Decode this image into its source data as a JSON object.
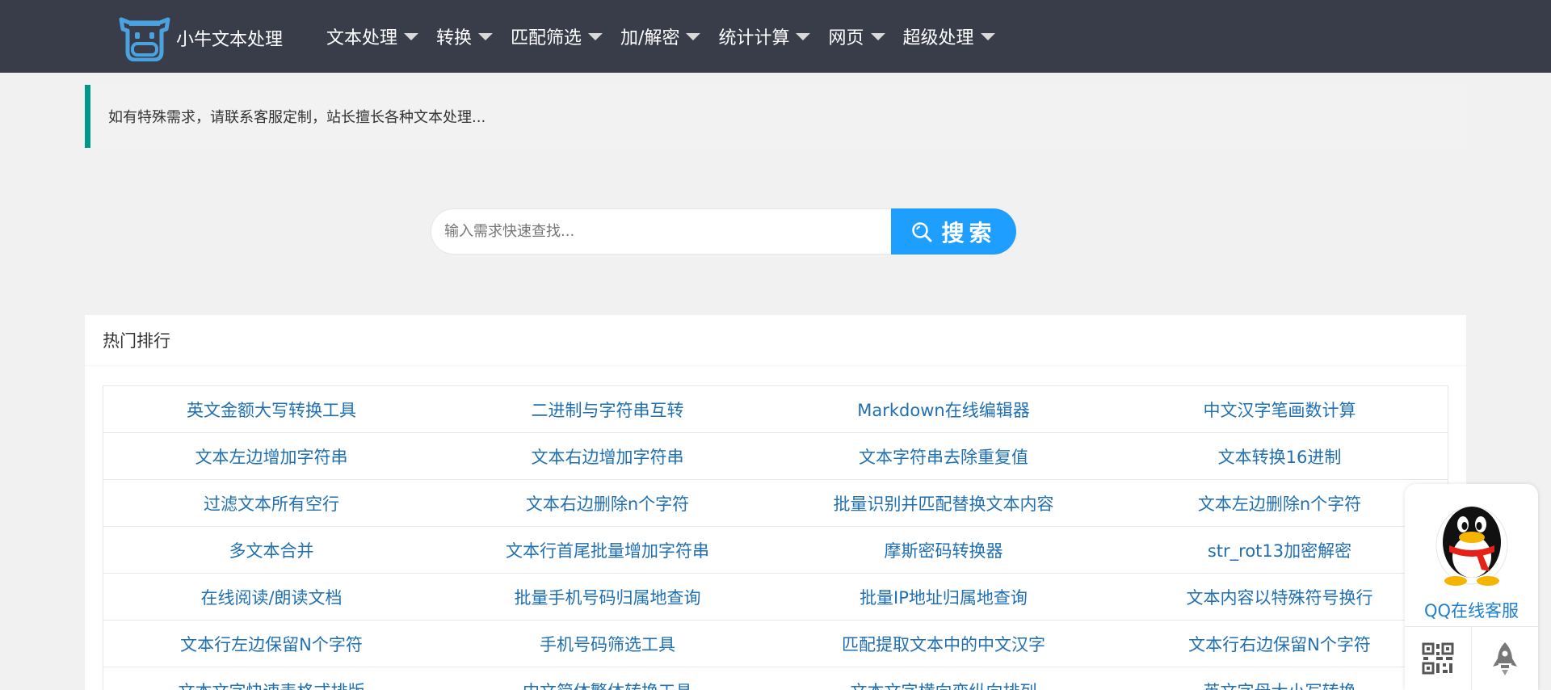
{
  "header": {
    "logo_text": "小牛文本处理",
    "nav": [
      {
        "label": "文本处理"
      },
      {
        "label": "转换"
      },
      {
        "label": "匹配筛选"
      },
      {
        "label": "加/解密"
      },
      {
        "label": "统计计算"
      },
      {
        "label": "网页"
      },
      {
        "label": "超级处理"
      }
    ]
  },
  "notice": {
    "text": "如有特殊需求，请联系客服定制，站长擅长各种文本处理..."
  },
  "search": {
    "placeholder": "输入需求快速查找...",
    "button_label": "搜索"
  },
  "hot": {
    "title": "热门排行",
    "rows": [
      [
        "英文金额大写转换工具",
        "二进制与字符串互转",
        "Markdown在线编辑器",
        "中文汉字笔画数计算"
      ],
      [
        "文本左边增加字符串",
        "文本右边增加字符串",
        "文本字符串去除重复值",
        "文本转换16进制"
      ],
      [
        "过滤文本所有空行",
        "文本右边删除n个字符",
        "批量识别并匹配替换文本内容",
        "文本左边删除n个字符"
      ],
      [
        "多文本合并",
        "文本行首尾批量增加字符串",
        "摩斯密码转换器",
        "str_rot13加密解密"
      ],
      [
        "在线阅读/朗读文档",
        "批量手机号码归属地查询",
        "批量IP地址归属地查询",
        "文本内容以特殊符号换行"
      ],
      [
        "文本行左边保留N个字符",
        "手机号码筛选工具",
        "匹配提取文本中的中文汉字",
        "文本行右边保留N个字符"
      ],
      [
        "文本文字快速表格式排版",
        "中文简体繁体转换工具",
        "文本文字横向变纵向排列",
        "英文字母大小写转换"
      ]
    ]
  },
  "float": {
    "qq_label": "QQ在线客服"
  },
  "colors": {
    "header_bg": "#393d49",
    "accent": "#009688",
    "search_btn": "#1e9fff",
    "link": "#1f6fb2"
  }
}
